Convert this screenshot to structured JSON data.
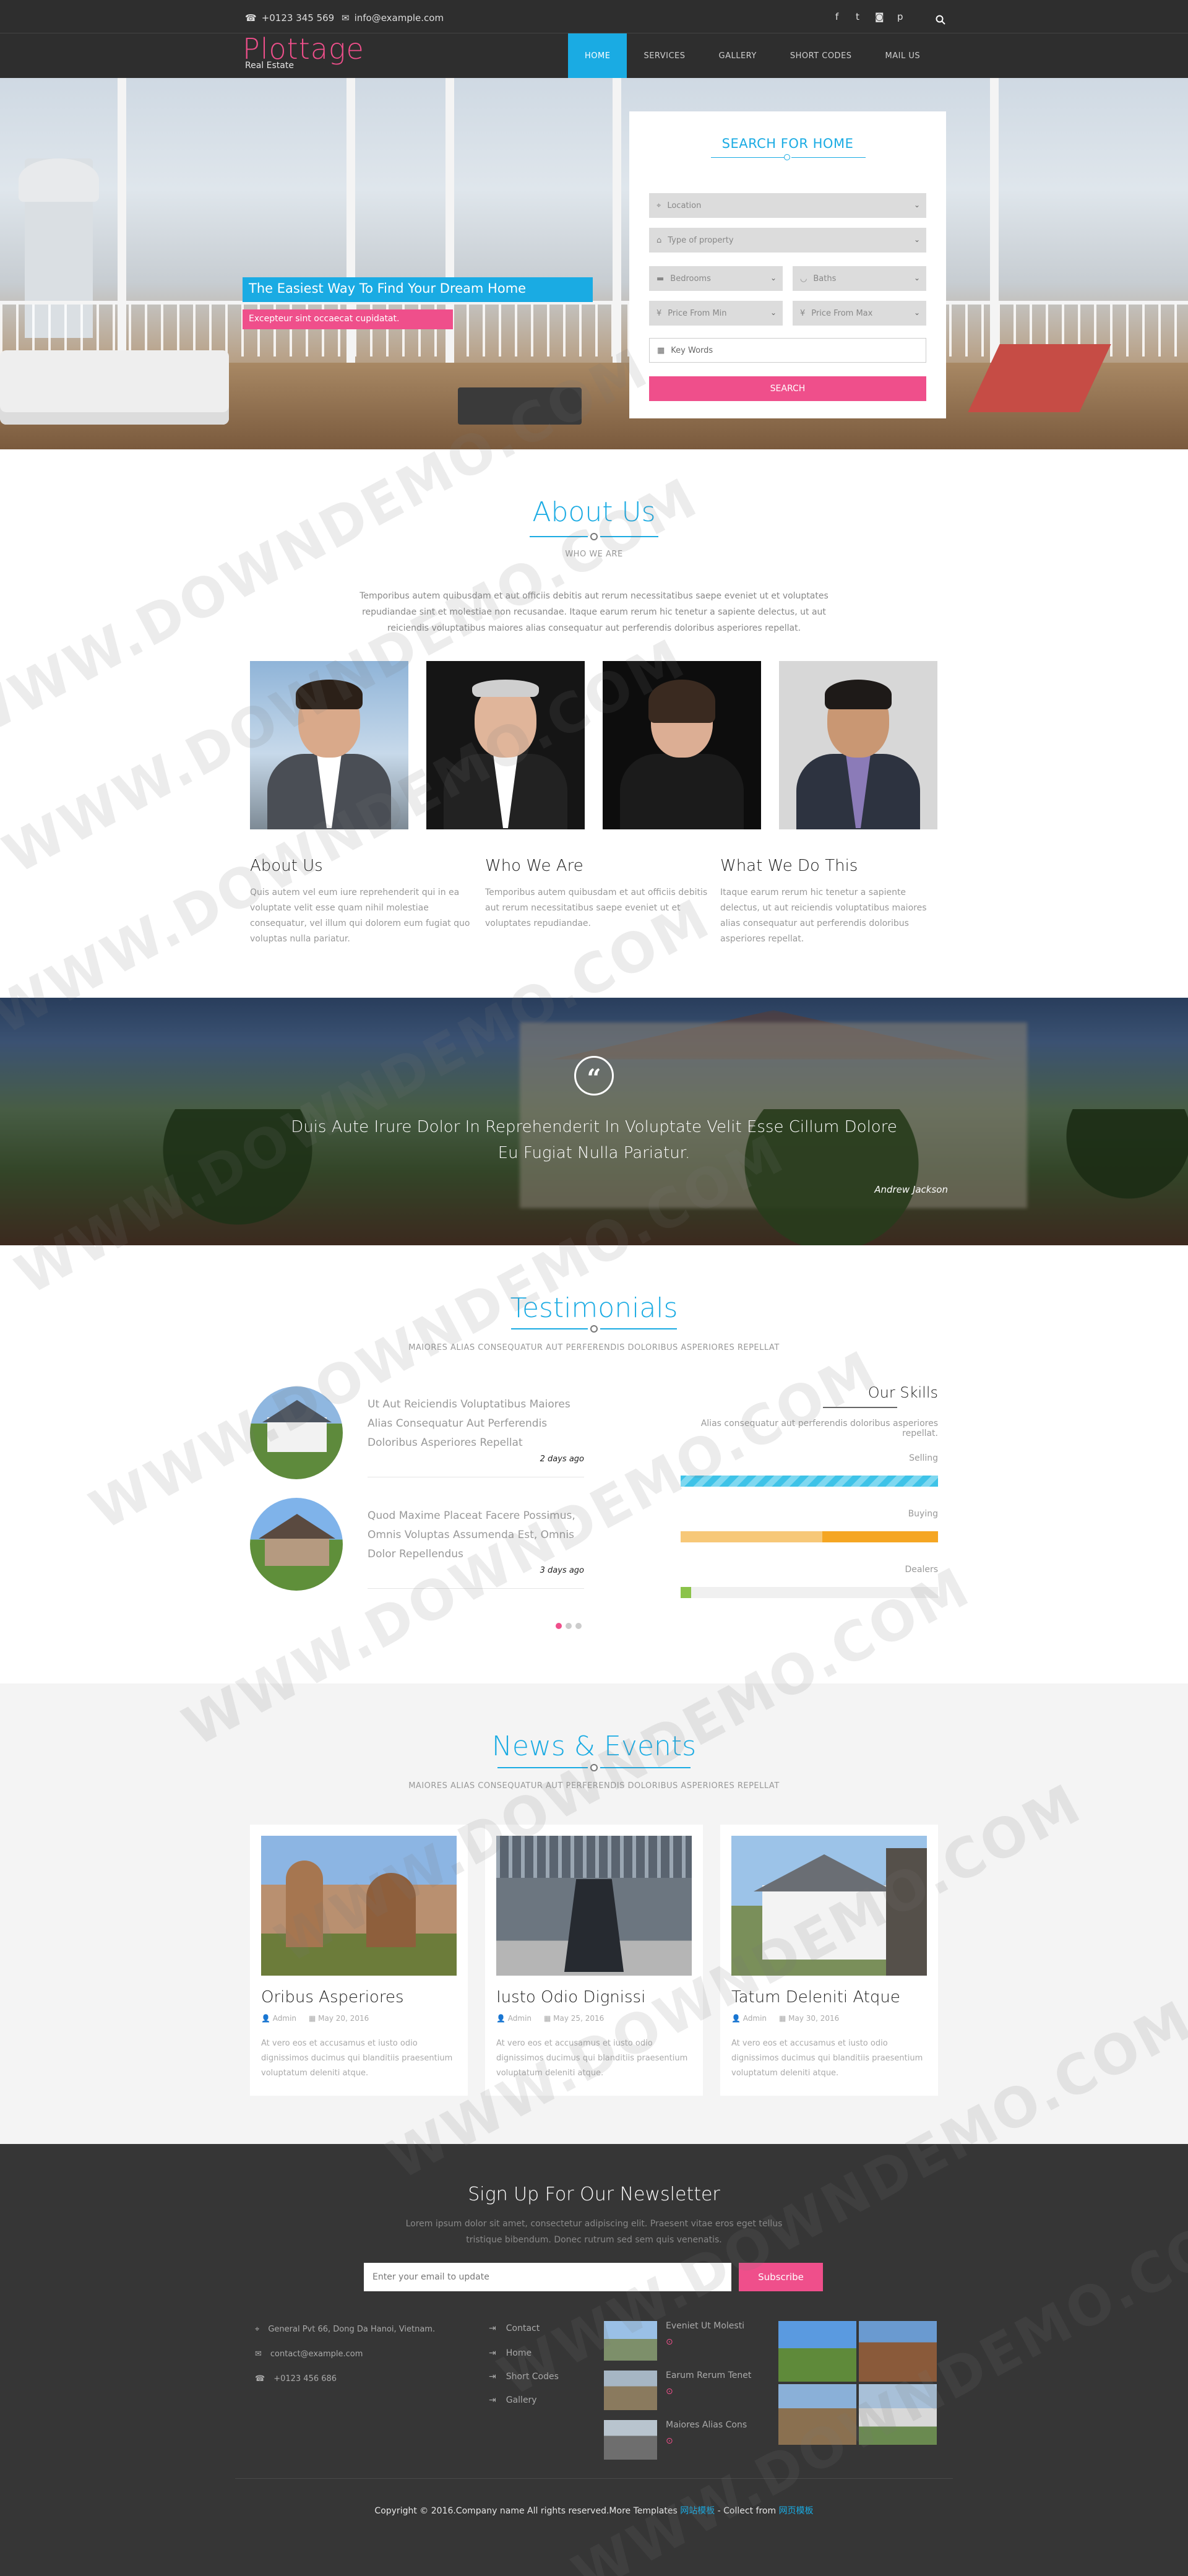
{
  "topbar": {
    "phone": "+0123 345 569",
    "email": "info@example.com",
    "social_icons": [
      "facebook-icon",
      "twitter-icon",
      "instagram-icon",
      "pinterest-icon"
    ],
    "social_glyphs": [
      "f",
      "t",
      "◙",
      "p"
    ]
  },
  "logo": {
    "brand": "Plottage",
    "tagline": "Real Estate"
  },
  "nav": {
    "items": [
      "HOME",
      "SERVICES",
      "GALLERY",
      "SHORT CODES",
      "MAIL US"
    ],
    "active": "HOME"
  },
  "hero": {
    "title": "The Easiest Way To Find Your Dream Home",
    "subtitle": "Excepteur sint occaecat cupidatat."
  },
  "search": {
    "title": "SEARCH FOR HOME",
    "location": "Location",
    "type": "Type of property",
    "bedrooms": "Bedrooms",
    "baths": "Baths",
    "price_min": "Price From Min",
    "price_max": "Price From Max",
    "keywords": "Key Words",
    "button": "SEARCH"
  },
  "about": {
    "title": "About Us",
    "subtitle": "WHO WE ARE",
    "text": "Temporibus autem quibusdam et aut officiis debitis aut rerum necessitatibus saepe eveniet ut et voluptates repudiandae sint et molestiae non recusandae. Itaque earum rerum hic tenetur a sapiente delectus, ut aut reiciendis voluptatibus maiores alias consequatur aut perferendis doloribus asperiores repellat.",
    "columns": [
      {
        "title": "About Us",
        "text": "Quis autem vel eum iure reprehenderit qui in ea voluptate velit esse quam nihil molestiae consequatur, vel illum qui dolorem eum fugiat quo voluptas nulla pariatur."
      },
      {
        "title": "Who We Are",
        "text": "Temporibus autem quibusdam et aut officiis debitis aut rerum necessitatibus saepe eveniet ut et voluptates repudiandae."
      },
      {
        "title": "What We Do This",
        "text": "Itaque earum rerum hic tenetur a sapiente delectus, ut aut reiciendis voluptatibus maiores alias consequatur aut perferendis doloribus asperiores repellat."
      }
    ]
  },
  "quote": {
    "mark": "“",
    "text": "Duis Aute Irure Dolor In Reprehenderit In Voluptate Velit Esse Cillum Dolore Eu Fugiat Nulla Pariatur.",
    "author": "Andrew Jackson"
  },
  "testimonials": {
    "title": "Testimonials",
    "subtitle": "MAIORES ALIAS CONSEQUATUR AUT PERFERENDIS DOLORIBUS ASPERIORES REPELLAT",
    "items": [
      {
        "text": "Ut Aut Reiciendis Voluptatibus Maiores Alias Consequatur Aut Perferendis Doloribus Asperiores Repellat",
        "date": "2 days ago"
      },
      {
        "text": "Quod Maxime Placeat Facere Possimus, Omnis Voluptas Assumenda Est, Omnis Dolor Repellendus",
        "date": "3 days ago"
      }
    ]
  },
  "skills": {
    "title": "Our Skills",
    "desc": "Alias consequatur aut perferendis doloribus asperiores repellat.",
    "items": [
      {
        "label": "Selling",
        "value": 1.0,
        "color": "#3ec3e8"
      },
      {
        "label": "Buying",
        "value": 1.0,
        "color": "#f5a623"
      },
      {
        "label": "Dealers",
        "value": 0.04,
        "color": "#8bc34a"
      }
    ]
  },
  "news": {
    "title": "News & Events",
    "subtitle": "MAIORES ALIAS CONSEQUATUR AUT PERFERENDIS DOLORIBUS ASPERIORES REPELLAT",
    "cards": [
      {
        "title": "Oribus Asperiores",
        "author": "Admin",
        "date": "May 20, 2016",
        "text": "At vero eos et accusamus et iusto odio dignissimos ducimus qui blanditiis praesentium voluptatum deleniti atque."
      },
      {
        "title": "Iusto Odio Dignissi",
        "author": "Admin",
        "date": "May 25, 2016",
        "text": "At vero eos et accusamus et iusto odio dignissimos ducimus qui blanditiis praesentium voluptatum deleniti atque."
      },
      {
        "title": "Tatum Deleniti Atque",
        "author": "Admin",
        "date": "May 30, 2016",
        "text": "At vero eos et accusamus et iusto odio dignissimos ducimus qui blanditiis praesentium voluptatum deleniti atque."
      }
    ]
  },
  "newsletter": {
    "title": "Sign Up For Our Newsletter",
    "text": "Lorem ipsum dolor sit amet, consectetur adipiscing elit. Praesent vitae eros eget tellus tristique bibendum. Donec rutrum sed sem quis venenatis.",
    "placeholder": "Enter your email to update",
    "button": "Subscribe"
  },
  "footer": {
    "address": "General Pvt 66, Dong Da Hanoi, Vietnam.",
    "email": "contact@example.com",
    "phone": "+0123 456 686",
    "links": [
      "Contact",
      "Home",
      "Short Codes",
      "Gallery"
    ],
    "posts": [
      "Eveniet Ut Molesti",
      "Earum Rerum Tenet",
      "Maiores Alias Cons"
    ],
    "copyright_prefix": "Copyright © 2016.Company name All rights reserved.More Templates ",
    "copyright_link1": "网站模板",
    "copyright_mid": " - Collect from ",
    "copyright_link2": "网页模板"
  },
  "watermark": "WWW.DOWNDEMO.COM",
  "colors": {
    "brand_pink": "#ef4f8b",
    "accent_blue": "#1aabe3",
    "dark": "#2e2e2e"
  }
}
